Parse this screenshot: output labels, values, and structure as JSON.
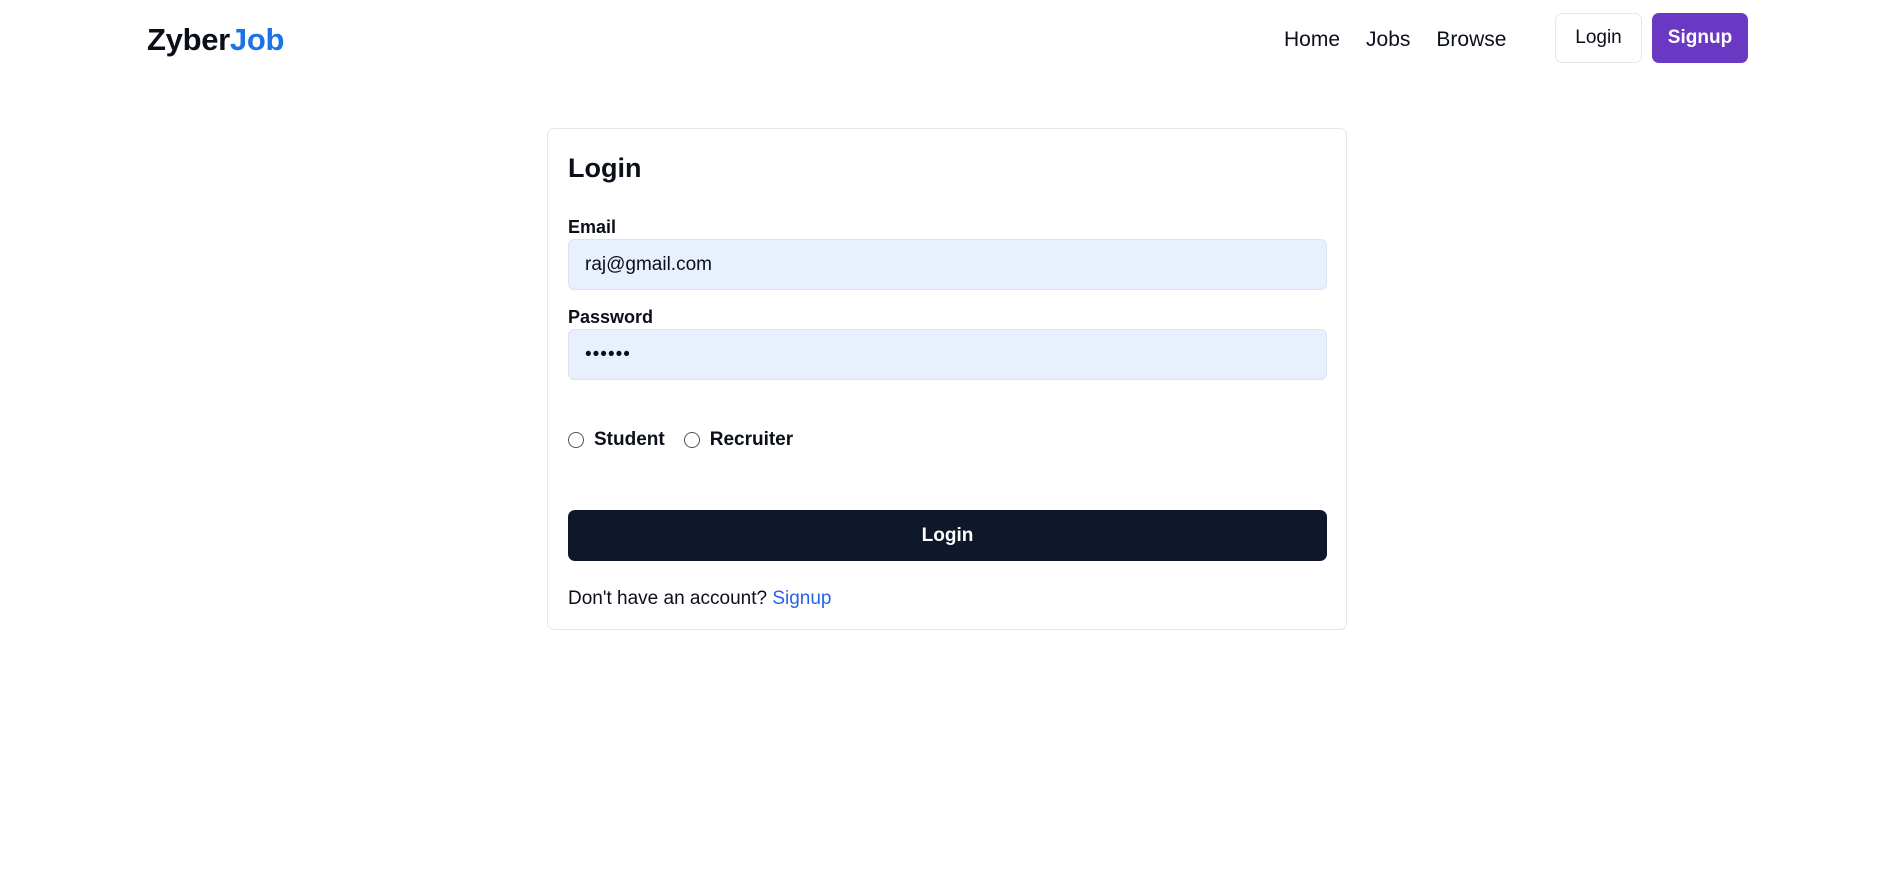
{
  "navbar": {
    "logo_part1": "Zyber",
    "logo_part2": "Job",
    "links": [
      "Home",
      "Jobs",
      "Browse"
    ],
    "login_label": "Login",
    "signup_label": "Signup"
  },
  "form": {
    "title": "Login",
    "email_label": "Email",
    "email_value": "raj@gmail.com",
    "password_label": "Password",
    "password_value": "••••••",
    "roles": [
      "Student",
      "Recruiter"
    ],
    "submit_label": "Login",
    "footer_text": "Don't have an account?",
    "footer_link": "Signup"
  },
  "colors": {
    "brand_blue": "#1a73e8",
    "signup_purple": "#6a38c2",
    "submit_dark": "#0f172a",
    "link_blue": "#2563eb",
    "input_fill": "#e8f0fe"
  }
}
